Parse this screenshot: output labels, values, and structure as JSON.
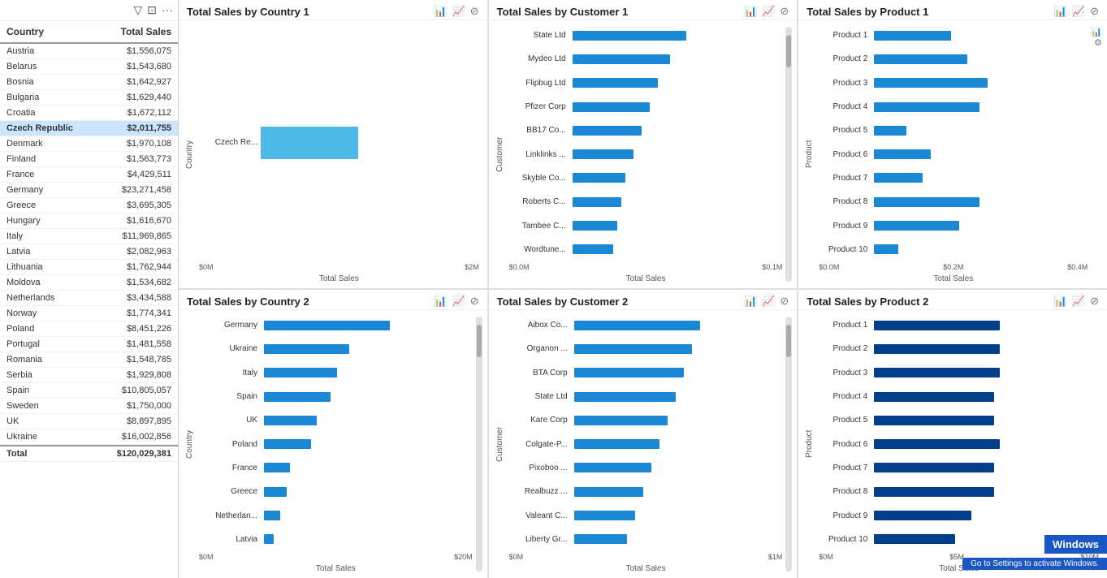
{
  "leftPanel": {
    "toolbar": {
      "filterIcon": "▽",
      "squareIcon": "⊡",
      "moreIcon": "···"
    },
    "header": {
      "country": "Country",
      "totalSales": "Total Sales"
    },
    "rows": [
      {
        "country": "Austria",
        "sales": "$1,556,075",
        "barWidth": 6,
        "selected": false
      },
      {
        "country": "Belarus",
        "sales": "$1,543,680",
        "barWidth": 6,
        "selected": false
      },
      {
        "country": "Bosnia",
        "sales": "$1,642,927",
        "barWidth": 6,
        "selected": false
      },
      {
        "country": "Bulgaria",
        "sales": "$1,629,440",
        "barWidth": 6,
        "selected": false
      },
      {
        "country": "Croatia",
        "sales": "$1,672,112",
        "barWidth": 6,
        "selected": false
      },
      {
        "country": "Czech Republic",
        "sales": "$2,011,755",
        "barWidth": 8,
        "selected": true
      },
      {
        "country": "Denmark",
        "sales": "$1,970,108",
        "barWidth": 7,
        "selected": false
      },
      {
        "country": "Finland",
        "sales": "$1,563,773",
        "barWidth": 6,
        "selected": false
      },
      {
        "country": "France",
        "sales": "$4,429,511",
        "barWidth": 16,
        "selected": false
      },
      {
        "country": "Germany",
        "sales": "$23,271,458",
        "barWidth": 80,
        "selected": false
      },
      {
        "country": "Greece",
        "sales": "$3,695,305",
        "barWidth": 13,
        "selected": false
      },
      {
        "country": "Hungary",
        "sales": "$1,616,670",
        "barWidth": 6,
        "selected": false
      },
      {
        "country": "Italy",
        "sales": "$11,969,865",
        "barWidth": 42,
        "selected": false
      },
      {
        "country": "Latvia",
        "sales": "$2,082,963",
        "barWidth": 8,
        "selected": false
      },
      {
        "country": "Lithuania",
        "sales": "$1,762,944",
        "barWidth": 7,
        "selected": false
      },
      {
        "country": "Moldova",
        "sales": "$1,534,682",
        "barWidth": 6,
        "selected": false
      },
      {
        "country": "Netherlands",
        "sales": "$3,434,588",
        "barWidth": 12,
        "selected": false
      },
      {
        "country": "Norway",
        "sales": "$1,774,341",
        "barWidth": 7,
        "selected": false
      },
      {
        "country": "Poland",
        "sales": "$8,451,226",
        "barWidth": 30,
        "selected": false
      },
      {
        "country": "Portugal",
        "sales": "$1,481,558",
        "barWidth": 5,
        "selected": false
      },
      {
        "country": "Romania",
        "sales": "$1,548,785",
        "barWidth": 6,
        "selected": false
      },
      {
        "country": "Serbia",
        "sales": "$1,929,808",
        "barWidth": 7,
        "selected": false
      },
      {
        "country": "Spain",
        "sales": "$10,805,057",
        "barWidth": 38,
        "selected": false
      },
      {
        "country": "Sweden",
        "sales": "$1,750,000",
        "barWidth": 6,
        "selected": false
      },
      {
        "country": "UK",
        "sales": "$8,897,895",
        "barWidth": 32,
        "selected": false
      },
      {
        "country": "Ukraine",
        "sales": "$16,002,856",
        "barWidth": 58,
        "selected": false
      }
    ],
    "total": {
      "label": "Total",
      "sales": "$120,029,381"
    }
  },
  "charts": {
    "topLeft": {
      "title": "Total Sales by Country 1",
      "yAxisLabel": "Country",
      "xAxisLabel": "Total Sales",
      "xTicks": [
        "$0M",
        "$2M"
      ],
      "bars": [
        {
          "label": "Czech Re...",
          "width": 120,
          "dark": false
        }
      ]
    },
    "topMiddle": {
      "title": "Total Sales by Customer 1",
      "yAxisLabel": "Customer",
      "xAxisLabel": "Total Sales",
      "xTicks": [
        "$0.0M",
        "$0.1M"
      ],
      "bars": [
        {
          "label": "State Ltd",
          "width": 140
        },
        {
          "label": "Mydeo Ltd",
          "width": 120
        },
        {
          "label": "Flipbug Ltd",
          "width": 105
        },
        {
          "label": "Pfizer Corp",
          "width": 95
        },
        {
          "label": "BB17 Co...",
          "width": 85
        },
        {
          "label": "Linklinks ...",
          "width": 75
        },
        {
          "label": "Skyble Co...",
          "width": 65
        },
        {
          "label": "Roberts C...",
          "width": 60
        },
        {
          "label": "Tambee C...",
          "width": 55
        },
        {
          "label": "Wordtune...",
          "width": 50
        }
      ]
    },
    "topRight": {
      "title": "Total Sales by Product 1",
      "yAxisLabel": "Product",
      "xAxisLabel": "Total Sales",
      "xTicks": [
        "$0.0M",
        "$0.2M",
        "$0.4M"
      ],
      "bars": [
        {
          "label": "Product 1",
          "width": 95
        },
        {
          "label": "Product 2",
          "width": 115
        },
        {
          "label": "Product 3",
          "width": 140
        },
        {
          "label": "Product 4",
          "width": 130
        },
        {
          "label": "Product 5",
          "width": 40
        },
        {
          "label": "Product 6",
          "width": 70
        },
        {
          "label": "Product 7",
          "width": 60
        },
        {
          "label": "Product 8",
          "width": 130
        },
        {
          "label": "Product 9",
          "width": 105
        },
        {
          "label": "Product 10",
          "width": 30
        }
      ]
    },
    "bottomLeft": {
      "title": "Total Sales by Country 2",
      "yAxisLabel": "Country",
      "xAxisLabel": "Total Sales",
      "xTicks": [
        "$0M",
        "$20M"
      ],
      "bars": [
        {
          "label": "Germany",
          "width": 155
        },
        {
          "label": "Ukraine",
          "width": 105
        },
        {
          "label": "Italy",
          "width": 90
        },
        {
          "label": "Spain",
          "width": 82
        },
        {
          "label": "UK",
          "width": 65
        },
        {
          "label": "Poland",
          "width": 58
        },
        {
          "label": "France",
          "width": 32
        },
        {
          "label": "Greece",
          "width": 28
        },
        {
          "label": "Netherlan...",
          "width": 20
        },
        {
          "label": "Latvia",
          "width": 12
        }
      ]
    },
    "bottomMiddle": {
      "title": "Total Sales by Customer 2",
      "yAxisLabel": "Customer",
      "xAxisLabel": "Total Sales",
      "xTicks": [
        "$0M",
        "$1M"
      ],
      "bars": [
        {
          "label": "Aibox Co...",
          "width": 155
        },
        {
          "label": "Organon ...",
          "width": 145
        },
        {
          "label": "BTA Corp",
          "width": 135
        },
        {
          "label": "State Ltd",
          "width": 125
        },
        {
          "label": "Kare Corp",
          "width": 115
        },
        {
          "label": "Colgate-P...",
          "width": 105
        },
        {
          "label": "Pixoboo ...",
          "width": 95
        },
        {
          "label": "Realbuzz ...",
          "width": 85
        },
        {
          "label": "Valeant C...",
          "width": 75
        },
        {
          "label": "Liberty Gr...",
          "width": 65
        }
      ]
    },
    "bottomRight": {
      "title": "Total Sales by Product 2",
      "yAxisLabel": "Product",
      "xAxisLabel": "Total Sales",
      "xTicks": [
        "$0M",
        "$5M",
        "$10M"
      ],
      "bars": [
        {
          "label": "Product 1",
          "width": 155
        },
        {
          "label": "Product 2",
          "width": 155
        },
        {
          "label": "Product 3",
          "width": 155
        },
        {
          "label": "Product 4",
          "width": 148
        },
        {
          "label": "Product 5",
          "width": 148
        },
        {
          "label": "Product 6",
          "width": 155
        },
        {
          "label": "Product 7",
          "width": 148
        },
        {
          "label": "Product 8",
          "width": 148
        },
        {
          "label": "Product 9",
          "width": 120
        },
        {
          "label": "Product 10",
          "width": 100
        }
      ]
    }
  },
  "icons": {
    "filter": "▽",
    "expand": "⊡",
    "more": "•••",
    "barChart1": "📊",
    "barChart2": "📈",
    "block": "⊘",
    "settings": "⚙"
  }
}
